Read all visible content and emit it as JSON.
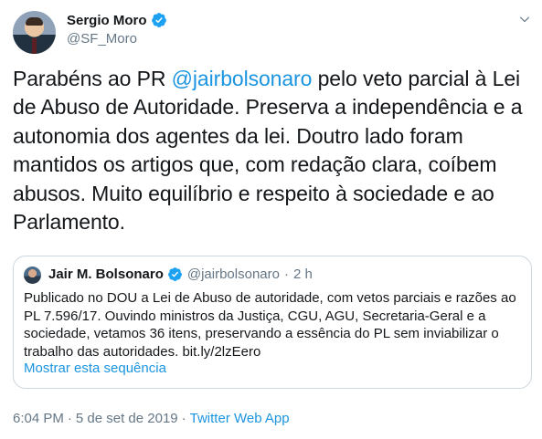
{
  "author": {
    "name": "Sergio Moro",
    "handle": "@SF_Moro",
    "verified": true
  },
  "tweet": {
    "text_before": "Parabéns ao PR ",
    "mention": "@jairbolsonaro",
    "text_after": " pelo veto parcial à Lei de Abuso de Autoridade. Preserva a independência e a autonomia dos agentes da lei. Doutro lado foram mantidos os artigos que, com redação clara, coíbem abusos. Muito equilíbrio e respeito à sociedade e ao Parlamento."
  },
  "quoted": {
    "name": "Jair M. Bolsonaro",
    "handle": "@jairbolsonaro",
    "separator": "·",
    "time": "2 h",
    "text": "Publicado no DOU a Lei de Abuso de autoridade, com vetos parciais e razões ao PL 7.596/17. Ouvindo  ministros da Justiça, CGU, AGU, Secretaria-Geral e a sociedade, vetamos 36 itens, preservando a essência do PL sem inviabilizar o trabalho das autoridades. bit.ly/2lzEero",
    "show_thread": "Mostrar esta sequência"
  },
  "meta": {
    "time": "6:04 PM",
    "separator": "·",
    "date": "5 de set de 2019",
    "app": "Twitter Web App"
  },
  "colors": {
    "accent": "#1b95e0",
    "secondary_text": "#657786",
    "border": "#ccd6dd"
  },
  "icons": {
    "verified": "verified-badge-icon",
    "menu": "chevron-down-icon"
  }
}
